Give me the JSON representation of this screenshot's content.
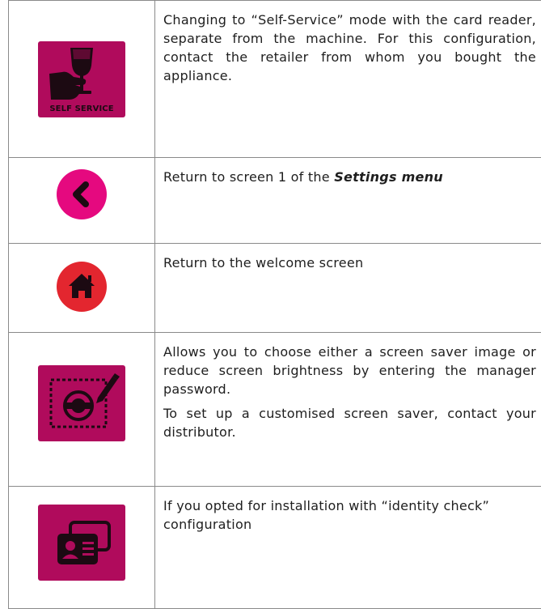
{
  "rows": [
    {
      "icon": "self-service-icon",
      "icon_label": "SELF SERVICE",
      "icon_color": "#b00b5c",
      "paragraphs": [
        "Changing to “Self-Service” mode with the card reader, separate from the machine.  For this configuration, contact the retailer from whom you bought the appliance."
      ]
    },
    {
      "icon": "back-arrow-icon",
      "icon_color": "#e5097f",
      "text_prefix": "Return to screen 1 of the ",
      "text_emphasis": "Settings menu"
    },
    {
      "icon": "home-icon",
      "icon_color": "#e3262f",
      "paragraphs": [
        "Return to the welcome screen"
      ]
    },
    {
      "icon": "screen-saver-icon",
      "icon_color": "#b00b5c",
      "paragraphs": [
        "Allows you to choose either a screen saver image or reduce screen brightness by entering the manager password.",
        "To set up a customised screen saver, contact your distributor."
      ]
    },
    {
      "icon": "identity-card-icon",
      "icon_color": "#b00b5c",
      "paragraphs": [
        "If you opted for installation with “identity check” configuration"
      ]
    }
  ]
}
